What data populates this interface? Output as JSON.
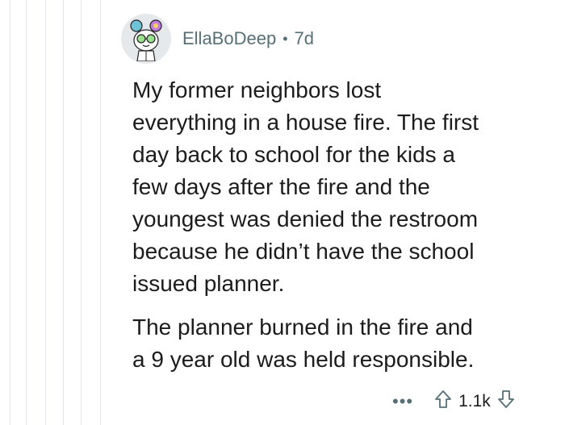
{
  "comment": {
    "author": "EllaBoDeep",
    "separator": "•",
    "age": "7d",
    "paragraphs": [
      "My former neighbors lost\neverything in a house fire. The first\nday back to school for the kids a\nfew days after the fire and the\nyoungest was denied the restroom\nbecause he didn’t have the school\nissued planner.",
      "The planner burned in the fire and\na 9 year old was held responsible."
    ],
    "more_label": "•••",
    "score": "1.1k",
    "icons": {
      "avatar": "cartoon-avatar-icon",
      "upvote": "upvote-arrow-icon",
      "downvote": "downvote-arrow-icon"
    }
  },
  "colors": {
    "meta_text": "#576f76",
    "body_text": "#1c1c1c",
    "thread_line": "#e3e5e8",
    "avatar_bg": "#e6e9ec"
  }
}
